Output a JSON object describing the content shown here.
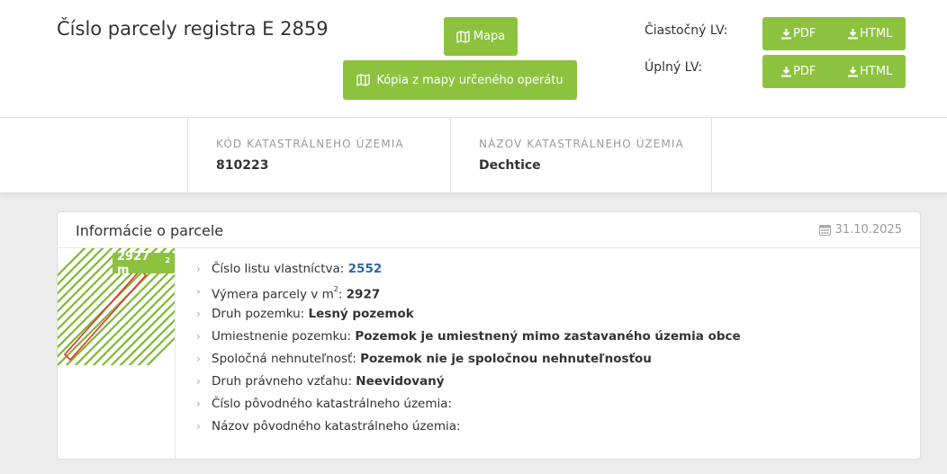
{
  "header": {
    "title": "Číslo parcely registra E 2859",
    "mapa_label": "Mapa",
    "kopia_label": "Kópia z mapy určeného operátu",
    "lv_ciastocny_label": "Čiastočný LV:",
    "lv_uplny_label": "Úplný LV:",
    "pdf_label": "PDF",
    "html_label": "HTML"
  },
  "katastralne_uzemie": {
    "kod_label": "Kód katastrálneho územia",
    "kod_value": "810223",
    "nazov_label": "Názov katastrálneho územia",
    "nazov_value": "Dechtice"
  },
  "card": {
    "title": "Informácie o parcele",
    "date": "31.10.2025",
    "area_badge_value": "2927 m",
    "area_badge_unit_sup": "2",
    "items": [
      {
        "label": "Číslo listu vlastníctva: ",
        "value": "2552",
        "link": true
      },
      {
        "label": "Výmera parcely v m",
        "sup": "2",
        "label_after": ": ",
        "value": "2927"
      },
      {
        "label": "Druh pozemku: ",
        "value": "Lesný pozemok"
      },
      {
        "label": "Umiestnenie pozemku: ",
        "value": "Pozemok je umiestnený mimo zastavaného územia obce"
      },
      {
        "label": "Spoločná nehnuteľnosť: ",
        "value": "Pozemok nie je spoločnou nehnuteľnosťou"
      },
      {
        "label": "Druh právneho vzťahu: ",
        "value": "Neevidovaný"
      },
      {
        "label": "Číslo pôvodného katastrálneho územia:",
        "value": ""
      },
      {
        "label": "Názov pôvodného katastrálneho územia:",
        "value": ""
      }
    ]
  },
  "colors": {
    "accent_green": "#8dc23f",
    "link_blue": "#2a6aa3",
    "parcel_outline": "#e8312f"
  },
  "icons": {
    "map": "map-icon",
    "download": "download-icon",
    "calendar": "calendar-icon",
    "chevron": "chevron-right-icon"
  }
}
